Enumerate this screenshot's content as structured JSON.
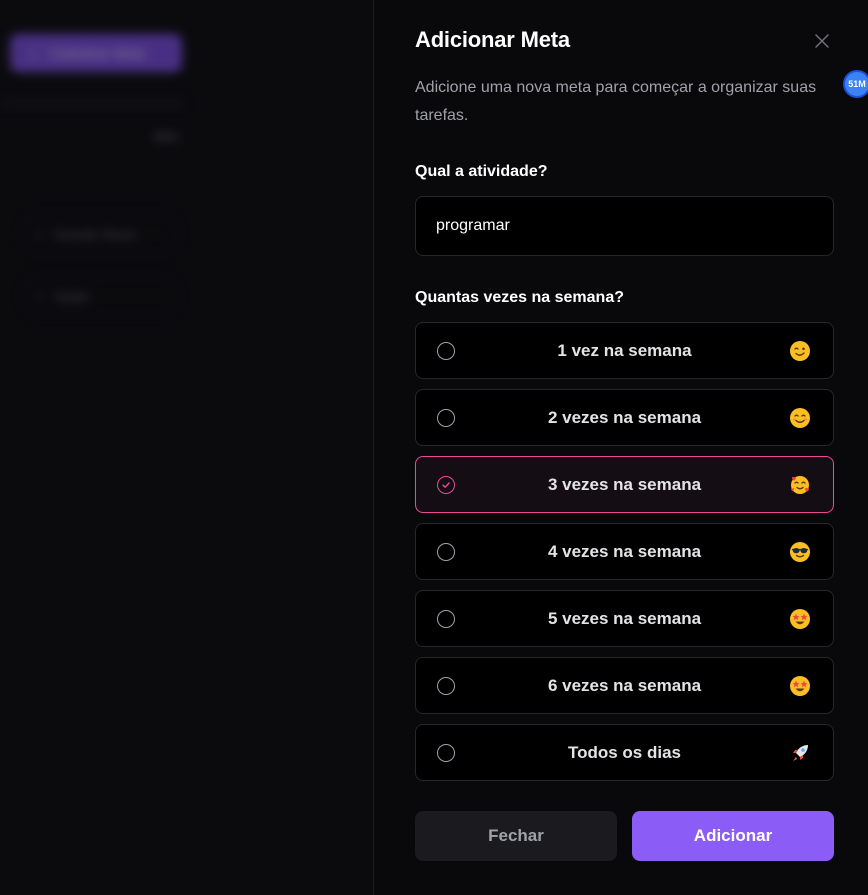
{
  "background": {
    "primary_button_label": "Cadastrar Meta",
    "percent_text": "65%",
    "items": [
      {
        "label": "Estudar React"
      },
      {
        "label": "Nadar"
      }
    ]
  },
  "dialog": {
    "title": "Adicionar Meta",
    "description": "Adicione uma nova meta para começar a organizar suas tarefas.",
    "activity_label": "Qual a atividade?",
    "activity_value": "programar",
    "frequency_label": "Quantas vezes na semana?",
    "frequency_options": [
      {
        "label": "1 vez na semana",
        "emoji": "wink-face-icon",
        "selected": false
      },
      {
        "label": "2 vezes na semana",
        "emoji": "smiling-face-icon",
        "selected": false
      },
      {
        "label": "3 vezes na semana",
        "emoji": "hearts-face-icon",
        "selected": true
      },
      {
        "label": "4 vezes na semana",
        "emoji": "sunglasses-face-icon",
        "selected": false
      },
      {
        "label": "5 vezes na semana",
        "emoji": "star-struck-face-icon",
        "selected": false
      },
      {
        "label": "6 vezes na semana",
        "emoji": "star-struck-face-icon",
        "selected": false
      },
      {
        "label": "Todos os dias",
        "emoji": "rocket-icon",
        "selected": false
      }
    ],
    "close_button_label": "Fechar",
    "submit_button_label": "Adicionar"
  },
  "badge": {
    "text": "51M"
  },
  "colors": {
    "accent": "#8b5cf6",
    "selected_border": "#ec4899",
    "background": "#09090b"
  }
}
